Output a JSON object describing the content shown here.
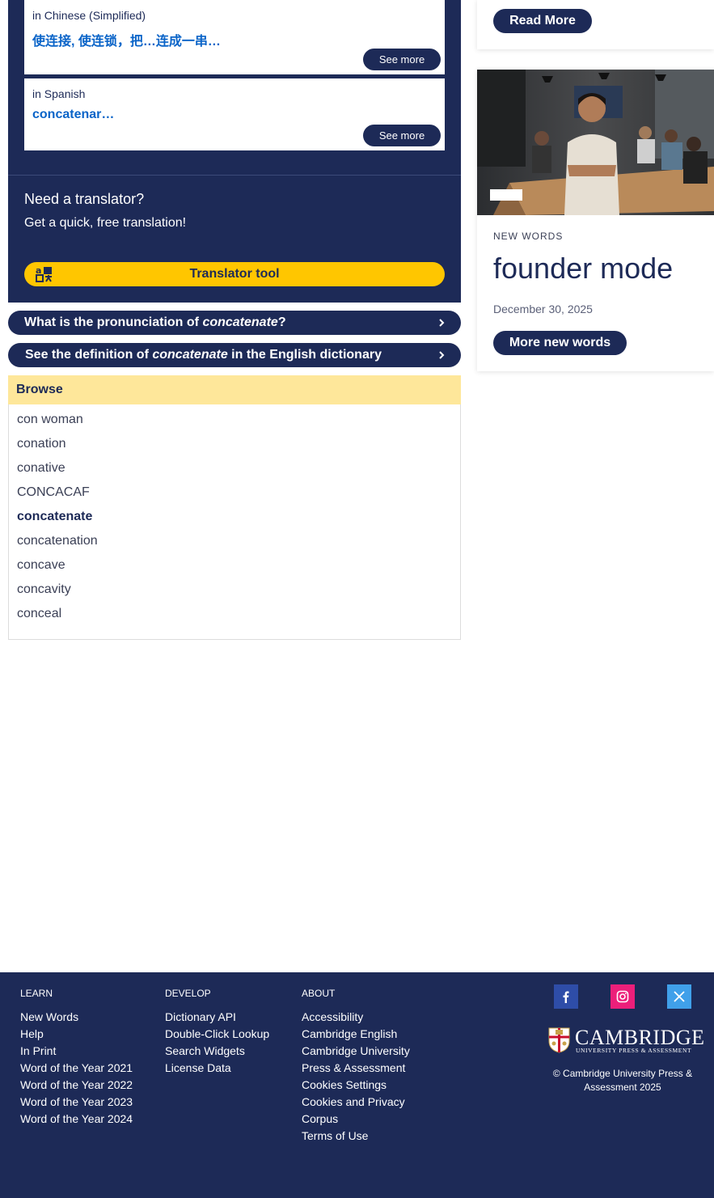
{
  "translations": [
    {
      "language": "in Chinese (Simplified)",
      "word": "使连接, 使连锁，把…连成一串…",
      "button": "See more"
    },
    {
      "language": "in Spanish",
      "word": "concatenar…",
      "button": "See more"
    }
  ],
  "translator_promo": {
    "title": "Need a translator?",
    "subtitle": "Get a quick, free translation!",
    "button": "Translator tool"
  },
  "links": {
    "pronunciation": {
      "before": "What is the pronunciation of ",
      "term": "concatenate",
      "after": "?"
    },
    "definition": {
      "before": "See the definition of ",
      "term": "concatenate",
      "after": " in the English dictionary"
    }
  },
  "browse": {
    "title": "Browse",
    "items": [
      "con woman",
      "conation",
      "conative",
      "CONCACAF",
      "concatenate",
      "concatenation",
      "concave",
      "concavity",
      "conceal"
    ],
    "current": "concatenate"
  },
  "sidebar": {
    "read_more": "Read More",
    "new_words": {
      "kicker": "NEW WORDS",
      "title": "founder mode",
      "date": "December 30, 2025",
      "button": "More new words"
    }
  },
  "footer": {
    "learn": {
      "heading": "LEARN",
      "links": [
        "New Words",
        "Help",
        "In Print",
        "Word of the Year 2021",
        "Word of the Year 2022",
        "Word of the Year 2023",
        "Word of the Year 2024"
      ]
    },
    "develop": {
      "heading": "DEVELOP",
      "links": [
        "Dictionary API",
        "Double-Click Lookup",
        "Search Widgets",
        "License Data"
      ]
    },
    "about": {
      "heading": "ABOUT",
      "links": [
        "Accessibility",
        "Cambridge English",
        "Cambridge University",
        "Press & Assessment",
        "Cookies Settings",
        "Cookies and Privacy",
        "Corpus",
        "Terms of Use"
      ]
    },
    "social_icons": [
      "facebook-icon",
      "instagram-icon",
      "x-icon"
    ],
    "logo": {
      "word": "CAMBRIDGE",
      "sub": "UNIVERSITY PRESS & ASSESSMENT"
    },
    "copyright": "© Cambridge University Press & Assessment 2025"
  },
  "colors": {
    "navy": "#1d2a57",
    "accent_yellow": "#ffc600",
    "browse_header": "#fee79a",
    "link_blue": "#0a64c8"
  }
}
